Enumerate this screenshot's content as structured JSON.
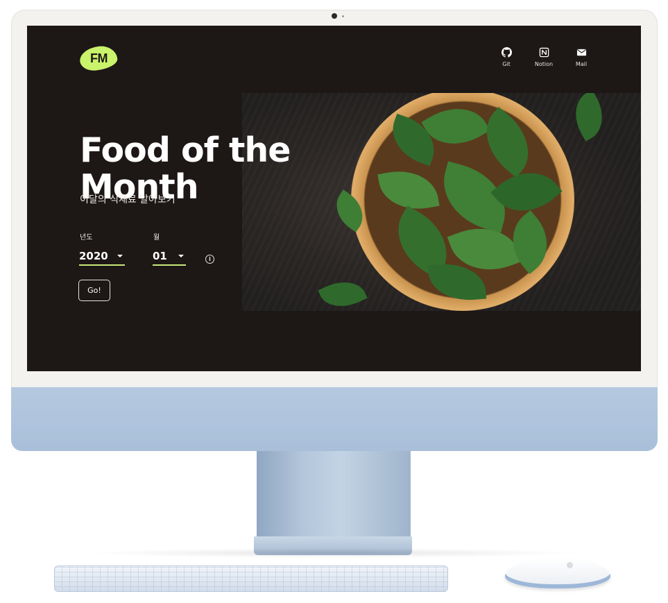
{
  "app": {
    "logo_text": "FM",
    "accent_color": "#c9f36a",
    "background_color": "#1d1716"
  },
  "nav": [
    {
      "label": "Git",
      "icon": "github-icon"
    },
    {
      "label": "Notion",
      "icon": "notion-icon"
    },
    {
      "label": "Mail",
      "icon": "mail-icon"
    }
  ],
  "hero": {
    "title": "Food of the Month",
    "subtitle": "이달의 식재료 알아보기",
    "image": "spinach-bowl-image"
  },
  "form": {
    "year_label": "년도",
    "year_value": "2020",
    "month_label": "월",
    "month_value": "01",
    "info_icon": "info-icon",
    "submit_label": "Go!"
  }
}
